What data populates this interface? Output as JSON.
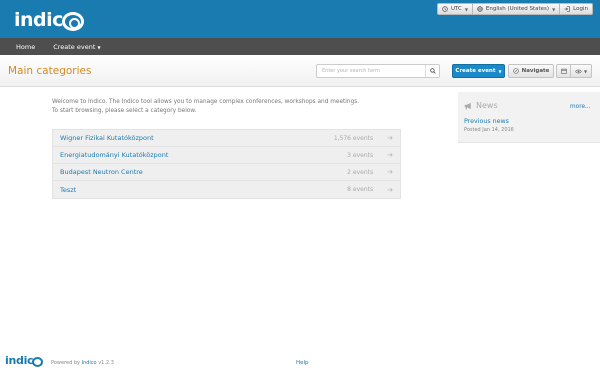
{
  "header": {
    "logo_text": "indico",
    "timezone": "UTC",
    "language": "English (United States)",
    "login": "Login"
  },
  "nav": {
    "home": "Home",
    "create_event": "Create event"
  },
  "subheader": {
    "title": "Main categories",
    "search_placeholder": "Enter your search term",
    "create_event_button": "Create event",
    "navigate_button": "Navigate"
  },
  "welcome": {
    "line1": "Welcome to Indico. The Indico tool allows you to manage complex conferences, workshops and meetings.",
    "line2": "To start browsing, please select a category below."
  },
  "categories": [
    {
      "name": "Wigner Fizikai Kutatóközpont",
      "events": "1,576 events"
    },
    {
      "name": "Energiatudományi Kutatóközpont",
      "events": "3 events"
    },
    {
      "name": "Budapest Neutron Centre",
      "events": "2 events"
    },
    {
      "name": "Teszt",
      "events": "8 events"
    }
  ],
  "news": {
    "title": "News",
    "more": "more...",
    "item_title": "Previous news",
    "item_date": "Posted Jan 14, 2016"
  },
  "footer": {
    "logo_text": "indico",
    "powered_by": "Powered by",
    "indico_link": "Indico",
    "version": "v1.2.3",
    "help": "Help"
  },
  "colors": {
    "topbar": "#1a7bb0",
    "navbar": "#4e4e4e",
    "title": "#d58a22",
    "link": "#1a7bb0",
    "primary_button": "#1a8acb"
  },
  "icons": {
    "timezone": "clock-icon",
    "language": "globe-icon",
    "login": "login-icon",
    "search": "search-icon",
    "navigate": "compass-icon",
    "calendar": "calendar-icon",
    "view": "eye-icon",
    "news": "megaphone-icon",
    "category_arrow": "arrow-right-icon"
  }
}
